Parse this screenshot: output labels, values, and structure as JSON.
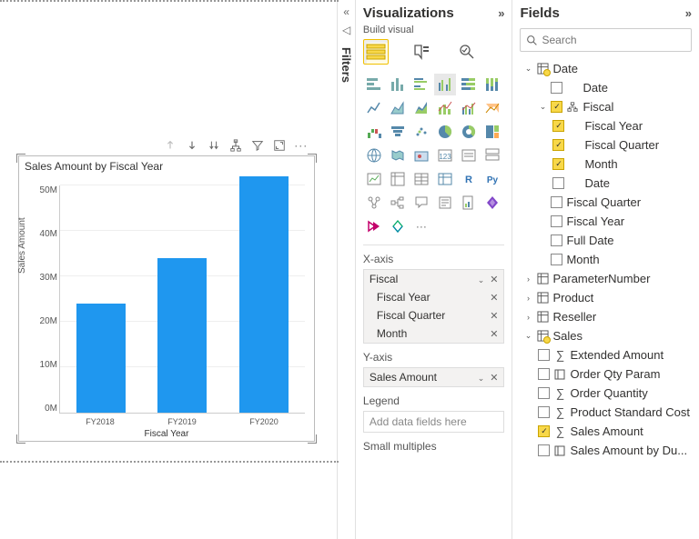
{
  "chart_data": {
    "type": "bar",
    "title": "Sales Amount by Fiscal Year",
    "xlabel": "Fiscal Year",
    "ylabel": "Sales Amount",
    "ylim": [
      0,
      50
    ],
    "yticks": [
      "50M",
      "40M",
      "30M",
      "20M",
      "10M",
      "0M"
    ],
    "categories": [
      "FY2018",
      "FY2019",
      "FY2020"
    ],
    "values": [
      24,
      34,
      52
    ]
  },
  "filters": {
    "label": "Filters"
  },
  "viz": {
    "title": "Visualizations",
    "build_label": "Build visual",
    "wells": {
      "xaxis": {
        "label": "X-axis",
        "group": "Fiscal",
        "items": [
          "Fiscal Year",
          "Fiscal Quarter",
          "Month"
        ]
      },
      "yaxis": {
        "label": "Y-axis",
        "items": [
          "Sales Amount"
        ]
      },
      "legend": {
        "label": "Legend",
        "placeholder": "Add data fields here"
      },
      "small_multiples": {
        "label": "Small multiples"
      }
    }
  },
  "fields": {
    "title": "Fields",
    "search_placeholder": "Search",
    "tree": {
      "date": {
        "label": "Date",
        "child_date": "Date",
        "fiscal": {
          "label": "Fiscal",
          "fiscal_year": "Fiscal Year",
          "fiscal_quarter": "Fiscal Quarter",
          "month": "Month",
          "date": "Date"
        },
        "fq": "Fiscal Quarter",
        "fy": "Fiscal Year",
        "full_date": "Full Date",
        "month": "Month"
      },
      "parameter_number": "ParameterNumber",
      "product": "Product",
      "reseller": "Reseller",
      "sales": {
        "label": "Sales",
        "extended_amount": "Extended Amount",
        "order_qty_param": "Order Qty Param",
        "order_quantity": "Order Quantity",
        "product_standard_cost": "Product Standard Cost",
        "sales_amount": "Sales Amount",
        "sales_amount_by_due": "Sales Amount by Du..."
      }
    }
  }
}
